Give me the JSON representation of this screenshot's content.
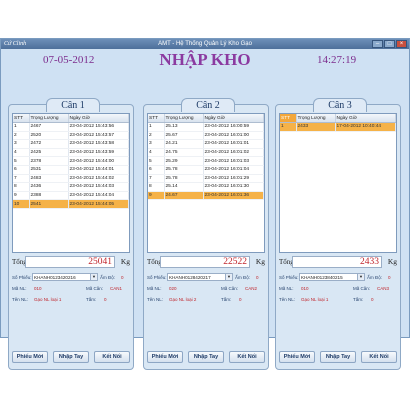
{
  "window": {
    "app_name": "Cứ Clinh",
    "title": "AMT - Hệ Thống Quản Lý Kho Gạo",
    "controls": [
      "minimize-icon",
      "maximize-icon",
      "close-icon"
    ]
  },
  "header": {
    "date": "07-05-2012",
    "title": "NHẬP KHO",
    "time": "14:27:19"
  },
  "columns": [
    "STT",
    "Trọng Lượng",
    "Ngày Giờ"
  ],
  "labels": {
    "total": "Tổng:",
    "unit": "Kg",
    "so_phieu": "Số Phiếu:",
    "am_do": "Ẩm Độ:",
    "ma_nl": "Mã NL:",
    "ma_can": "Mã Cân:",
    "ten_nl": "Tên NL:",
    "tam": "Tấm:"
  },
  "buttons": {
    "phieu_moi": "Phiếu Mới",
    "nhap_tay": "Nhập Tay",
    "ket_noi": "Kết Nối"
  },
  "colors": {
    "accent": "#8b3aa0",
    "highlight": "#f5b248",
    "value_red": "#c0242b"
  },
  "panels": [
    {
      "name": "Cân 1",
      "rows": [
        [
          "1",
          "2467",
          "23-04-2012 15:43:56"
        ],
        [
          "2",
          "2520",
          "23-04-2012 15:43:57"
        ],
        [
          "3",
          "2472",
          "23-04-2012 15:43:58"
        ],
        [
          "4",
          "2425",
          "23-04-2012 15:43:59"
        ],
        [
          "5",
          "2378",
          "23-04-2012 15:44:00"
        ],
        [
          "6",
          "2531",
          "23-04-2012 15:44:01"
        ],
        [
          "7",
          "2483",
          "23-04-2012 15:44:02"
        ],
        [
          "8",
          "2436",
          "23-04-2012 15:44:03"
        ],
        [
          "9",
          "2388",
          "23-04-2012 15:44:04"
        ],
        [
          "10",
          "2541",
          "23-04-2012 15:44:05"
        ]
      ],
      "highlight_row": 9,
      "total": "25041",
      "so_phieu": "KHANH0123420216",
      "am_do": "0",
      "ma_nl": "010",
      "ma_can": "CAN1",
      "ten_nl": "Gạo NL loại 1",
      "tam": "0"
    },
    {
      "name": "Cân 2",
      "rows": [
        [
          "1",
          "25.13",
          "23-04-2012 16:00:59"
        ],
        [
          "2",
          "25.67",
          "23-04-2012 16:01:00"
        ],
        [
          "3",
          "24.21",
          "23-04-2012 16:01:01"
        ],
        [
          "4",
          "24.75",
          "23-04-2012 16:01:02"
        ],
        [
          "5",
          "25.29",
          "23-04-2012 16:01:03"
        ],
        [
          "6",
          "25.78",
          "23-04-2012 16:01:04"
        ],
        [
          "7",
          "25.78",
          "23-04-2012 16:01:29"
        ],
        [
          "8",
          "25.14",
          "23-04-2012 16:01:30"
        ],
        [
          "9",
          "24.67",
          "23-04-2012 16:01:36"
        ]
      ],
      "highlight_row": 8,
      "total": "22522",
      "so_phieu": "KHANH0128420217",
      "am_do": "0",
      "ma_nl": "020",
      "ma_can": "CAN2",
      "ten_nl": "Gạo NL loại 2",
      "tam": "0"
    },
    {
      "name": "Cân 3",
      "rows": [
        [
          "1",
          "2433",
          "17-04-2012 10:40:44"
        ]
      ],
      "highlight_row": 0,
      "total": "2433",
      "so_phieu": "KHANH0123840215",
      "am_do": "0",
      "ma_nl": "010",
      "ma_can": "CAN3",
      "ten_nl": "Gạo NL loại 1",
      "tam": "0"
    }
  ]
}
